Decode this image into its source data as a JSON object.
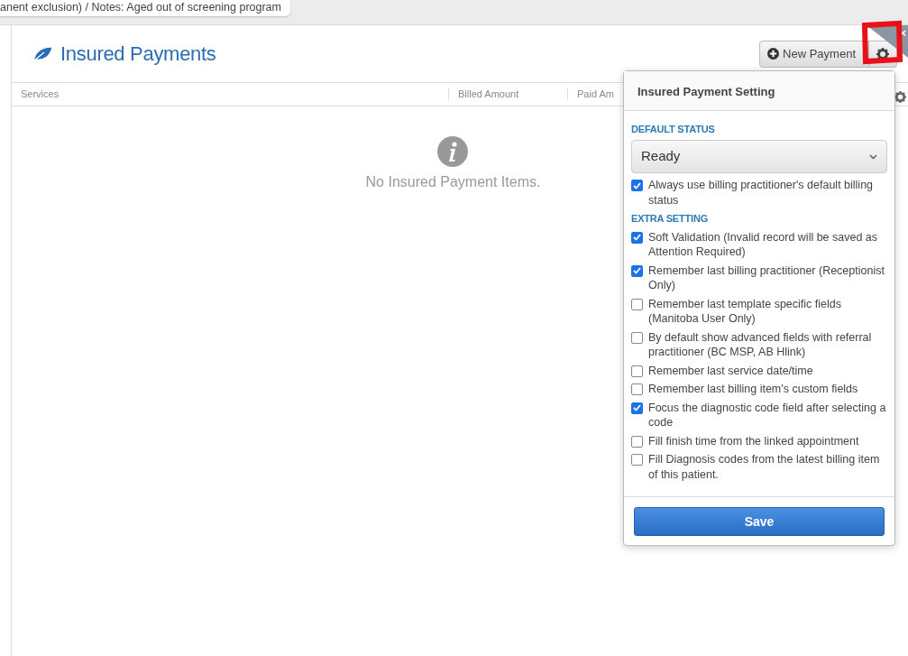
{
  "top_tab": {
    "text": "anent exclusion) / Notes: Aged out of screening program"
  },
  "page": {
    "title": "Insured Payments",
    "buttons": [
      {
        "kind": "new",
        "label": "New Payment"
      },
      {
        "kind": "settings"
      }
    ]
  },
  "table": {
    "columns": [
      "Services",
      "Billed Amount",
      "Paid Am"
    ]
  },
  "empty_state": {
    "text": "No Insured Payment Items."
  },
  "popover": {
    "title": "Insured Payment Setting",
    "sections": [
      {
        "heading": "DEFAULT STATUS",
        "select": {
          "value": "Ready"
        },
        "options": [
          {
            "label": "Always use billing practitioner's default billing status",
            "checked": true
          }
        ]
      },
      {
        "heading": "EXTRA SETTING",
        "options": [
          {
            "label": "Soft Validation (Invalid record will be saved as Attention Required)",
            "checked": true
          },
          {
            "label": "Remember last billing practitioner (Receptionist Only)",
            "checked": true
          },
          {
            "label": "Remember last template specific fields (Manitoba User Only)",
            "checked": false
          },
          {
            "label": "By default show advanced fields with referral practitioner (BC MSP, AB Hlink)",
            "checked": false
          },
          {
            "label": "Remember last service date/time",
            "checked": false
          },
          {
            "label": "Remember last billing item's custom fields",
            "checked": false
          },
          {
            "label": "Focus the diagnostic code field after selecting a code",
            "checked": true
          },
          {
            "label": "Fill finish time from the linked appointment",
            "checked": false
          },
          {
            "label": "Fill Diagnosis codes from the latest billing item of this patient.",
            "checked": false
          }
        ]
      }
    ],
    "save": "Save"
  },
  "corner_close": "×"
}
